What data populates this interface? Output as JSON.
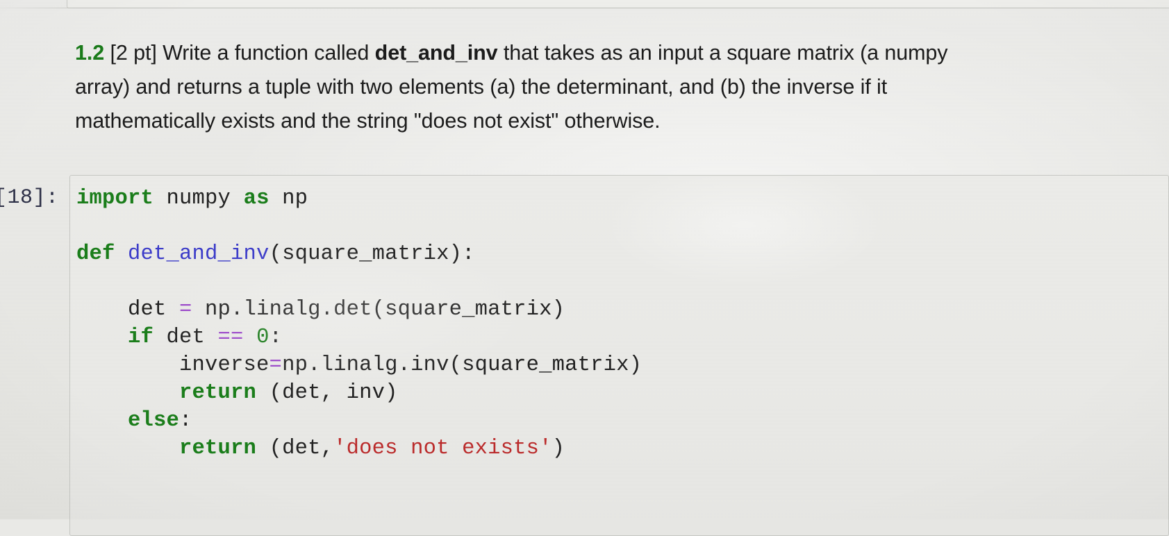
{
  "notebook": {
    "prompt_label": "[18]:",
    "markdown": {
      "line1_prefix_number": "1.2",
      "line1_a": " [2 pt] Write a function called ",
      "line1_bold": "det_and_inv",
      "line1_b": " that takes as an input a square matrix (a numpy",
      "line2": "array) and returns a tuple with two elements (a) the determinant, and (b) the inverse if it",
      "line3": "mathematically exists and the string \"does not exist\" otherwise.",
      "full_text": "1.2 [2 pt] Write a function called det_and_inv that takes as an input a square matrix (a numpy array) and returns a tuple with two elements (a) the determinant, and (b) the inverse if it mathematically exists and the string \"does not exist\" otherwise."
    },
    "code_cell": {
      "language": "python",
      "full_source": "import numpy as np\n\ndef det_and_inv(square_matrix):\n\n    det = np.linalg.det(square_matrix)\n    if det == 0:\n        inverse=np.linalg.inv(square_matrix)\n        return (det, inv)\n    else:\n        return (det,'does not exists')",
      "lines": [
        {
          "n": 1,
          "tokens": [
            {
              "t": "import",
              "c": "kw"
            },
            {
              "t": " numpy ",
              "c": "pl"
            },
            {
              "t": "as",
              "c": "kw"
            },
            {
              "t": " np",
              "c": "pl"
            }
          ]
        },
        {
          "n": 2,
          "tokens": []
        },
        {
          "n": 3,
          "tokens": [
            {
              "t": "def",
              "c": "kw"
            },
            {
              "t": " ",
              "c": "pl"
            },
            {
              "t": "det_and_inv",
              "c": "fn"
            },
            {
              "t": "(square_matrix):",
              "c": "pl"
            }
          ]
        },
        {
          "n": 4,
          "tokens": []
        },
        {
          "n": 5,
          "tokens": [
            {
              "t": "    det ",
              "c": "pl"
            },
            {
              "t": "=",
              "c": "op"
            },
            {
              "t": " np.linalg.det(square_matrix)",
              "c": "pl"
            }
          ]
        },
        {
          "n": 6,
          "tokens": [
            {
              "t": "    ",
              "c": "pl"
            },
            {
              "t": "if",
              "c": "kw"
            },
            {
              "t": " det ",
              "c": "pl"
            },
            {
              "t": "==",
              "c": "op"
            },
            {
              "t": " ",
              "c": "pl"
            },
            {
              "t": "0",
              "c": "num"
            },
            {
              "t": ":",
              "c": "pl"
            }
          ]
        },
        {
          "n": 7,
          "tokens": [
            {
              "t": "        inverse",
              "c": "pl"
            },
            {
              "t": "=",
              "c": "op"
            },
            {
              "t": "np.linalg.inv(square_matrix)",
              "c": "pl"
            }
          ]
        },
        {
          "n": 8,
          "tokens": [
            {
              "t": "        ",
              "c": "pl"
            },
            {
              "t": "return",
              "c": "kw"
            },
            {
              "t": " (det, inv)",
              "c": "pl"
            }
          ]
        },
        {
          "n": 9,
          "tokens": [
            {
              "t": "    ",
              "c": "pl"
            },
            {
              "t": "else",
              "c": "kw"
            },
            {
              "t": ":",
              "c": "pl"
            }
          ]
        },
        {
          "n": 10,
          "tokens": [
            {
              "t": "        ",
              "c": "pl"
            },
            {
              "t": "return",
              "c": "kw"
            },
            {
              "t": " (det,",
              "c": "pl"
            },
            {
              "t": "'does not exists'",
              "c": "str"
            },
            {
              "t": ")",
              "c": "pl"
            }
          ]
        }
      ]
    }
  },
  "colors": {
    "keyword": "#1a7d1a",
    "function_name": "#3b3bc9",
    "operator": "#9a46c9",
    "number": "#197a19",
    "string": "#bb2a2a",
    "plain_text": "#212121",
    "prompt": "#2c2f46",
    "cell_background": "#e9e9e6",
    "cell_border": "#c6c7c3",
    "page_background": "#e9e9e6"
  }
}
